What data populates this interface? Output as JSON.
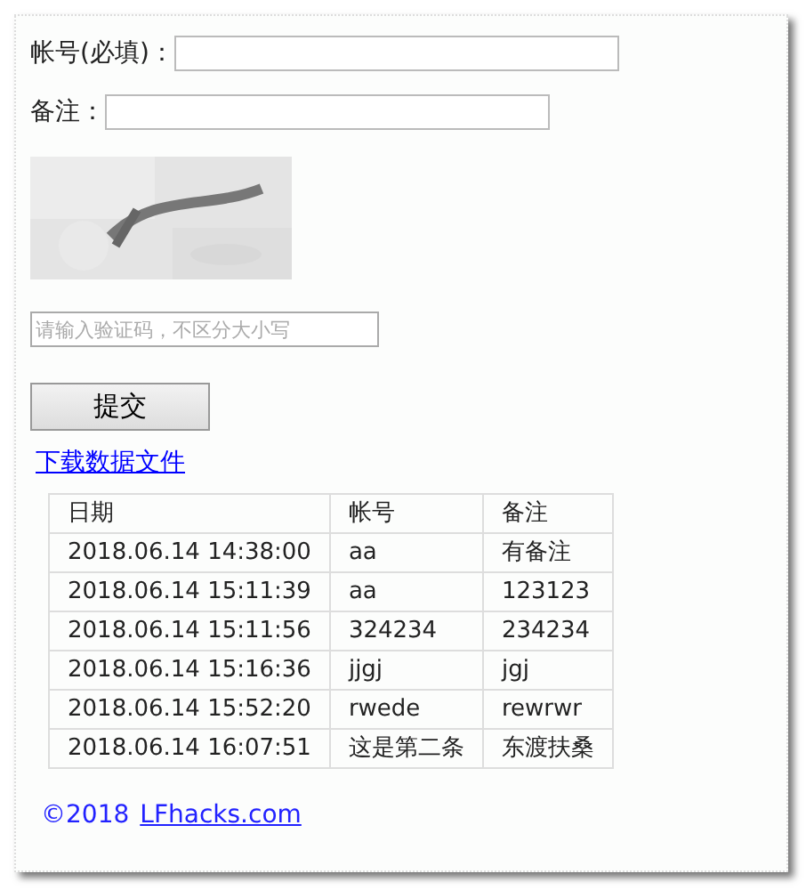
{
  "form": {
    "fields": [
      {
        "label": "帐号(必填)："
      },
      {
        "label": "备注："
      }
    ],
    "code_field": {
      "placeholder": "请输入验证码，不区分大小写"
    },
    "submit": "提交"
  },
  "download_link": "下载数据文件",
  "table": {
    "columns": [
      "日期",
      "帐号",
      "备注"
    ],
    "rows": [
      [
        "2018.06.14 14:38:00",
        "aa",
        "有备注"
      ],
      [
        "2018.06.14 15:11:39",
        "aa",
        "123123"
      ],
      [
        "2018.06.14 15:11:56",
        "324234",
        "234234"
      ],
      [
        "2018.06.14 15:16:36",
        "jjgj",
        "jgj"
      ],
      [
        "2018.06.14 15:52:20",
        "rwede",
        "rewrwr"
      ],
      [
        "2018.06.14 16:07:51",
        "这是第二条",
        "东渡扶桑"
      ]
    ]
  },
  "footer": {
    "copyright": "©2018",
    "link": "LFhacks.com"
  }
}
